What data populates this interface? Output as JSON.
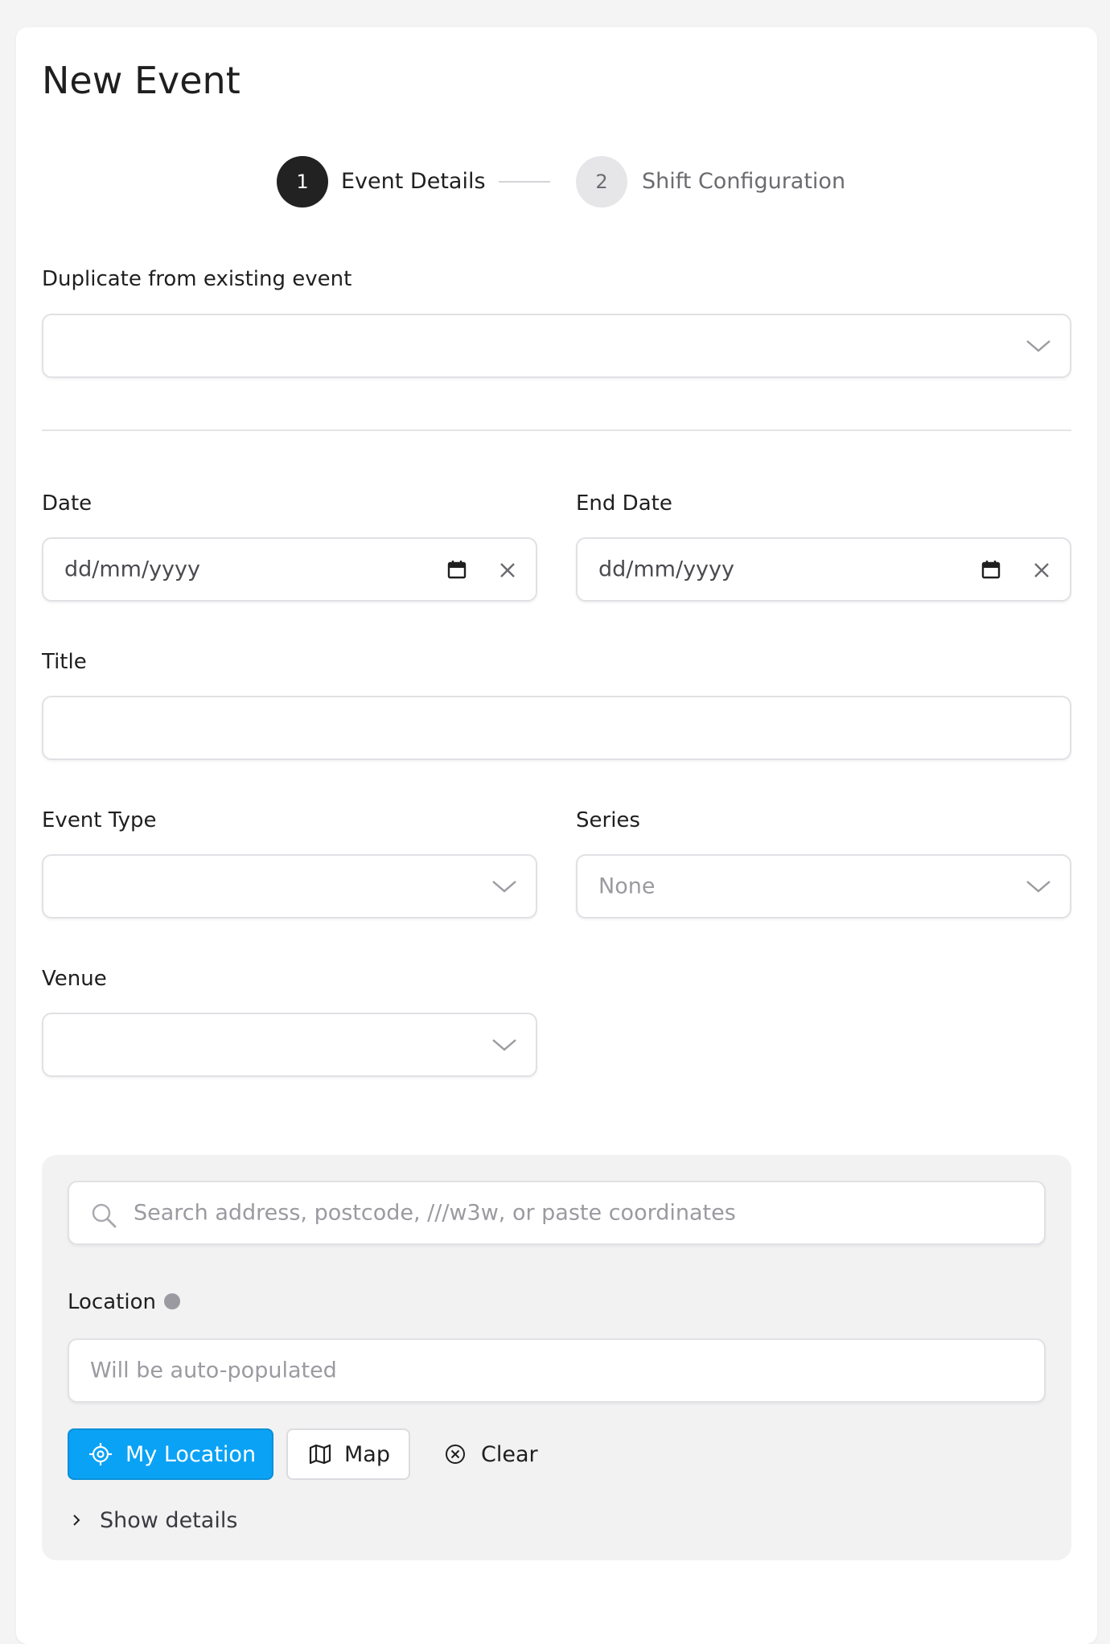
{
  "page": {
    "title": "New Event"
  },
  "stepper": {
    "steps": [
      {
        "number": "1",
        "label": "Event Details"
      },
      {
        "number": "2",
        "label": "Shift Configuration"
      }
    ]
  },
  "duplicate": {
    "label": "Duplicate from existing event",
    "value": ""
  },
  "date": {
    "label": "Date",
    "placeholder": "dd/mm/yyyy"
  },
  "end_date": {
    "label": "End Date",
    "placeholder": "dd/mm/yyyy"
  },
  "title_field": {
    "label": "Title",
    "value": ""
  },
  "event_type": {
    "label": "Event Type",
    "value": ""
  },
  "series": {
    "label": "Series",
    "value": "None"
  },
  "venue": {
    "label": "Venue",
    "value": ""
  },
  "location_panel": {
    "search_placeholder": "Search address, postcode, ///w3w, or paste coordinates",
    "location_label": "Location",
    "location_placeholder": "Will be auto-populated",
    "my_location_label": "My Location",
    "map_label": "Map",
    "clear_label": "Clear",
    "show_details_label": "Show details"
  },
  "colors": {
    "accent": "#0aa2f5",
    "step_active": "#222222",
    "step_inactive": "#e6e6e8"
  }
}
